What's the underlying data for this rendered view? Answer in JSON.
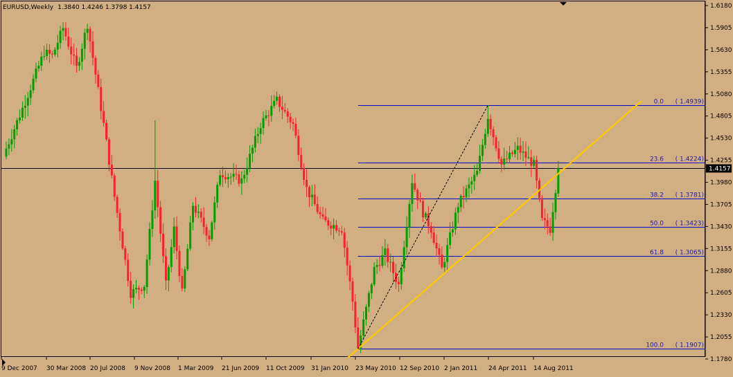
{
  "header": {
    "symbol": "EURUSD,Weekly",
    "ohlc": "1.3840 1.4246 1.3798 1.4157"
  },
  "colors": {
    "background": "#D2AF83",
    "bull": "#00A000",
    "bear": "#FF1E2D",
    "fib_line": "#0000CC",
    "fib_label": "#2020AA",
    "trend_dotted": "#FFC800",
    "trend_dashed": "#000000",
    "price_line": "#000000",
    "current_price_bg": "#000000",
    "current_price_text": "#FFFFFF"
  },
  "chart_data": {
    "type": "candlestick",
    "symbol": "EURUSD",
    "timeframe": "Weekly",
    "current_price": 1.4157,
    "current_price_label": "1.4157",
    "ylim": [
      1.178,
      1.618
    ],
    "y_ticks": [
      "1.6180",
      "1.5905",
      "1.5630",
      "1.5355",
      "1.5080",
      "1.4805",
      "1.4530",
      "1.4255",
      "1.3980",
      "1.3705",
      "1.3430",
      "1.3155",
      "1.2880",
      "1.2605",
      "1.2330",
      "1.2055",
      "1.1780"
    ],
    "x_labels": [
      "9 Dec 2007",
      "30 Mar 2008",
      "20 Jul 2008",
      "9 Nov 2008",
      "1 Mar 2009",
      "21 Jun 2009",
      "11 Oct 2009",
      "31 Jan 2010",
      "23 May 2010",
      "12 Sep 2010",
      "2 Jan 2011",
      "24 Apr 2011",
      "14 Aug 2011"
    ],
    "fibonacci": [
      {
        "level": "0.0",
        "price_label": "( 1.4939)",
        "price": 1.4939
      },
      {
        "level": "23.6",
        "price_label": "( 1.4224)",
        "price": 1.4224
      },
      {
        "level": "38.2",
        "price_label": "( 1.3781)",
        "price": 1.3781
      },
      {
        "level": "50.0",
        "price_label": "( 1.3423)",
        "price": 1.3423
      },
      {
        "level": "61.8",
        "price_label": "( 1.3065)",
        "price": 1.3065
      },
      {
        "level": "100.0",
        "price_label": "( 1.1907)",
        "price": 1.1907
      }
    ],
    "fib_anchor_week": 130,
    "fib_end_week": 208,
    "trendlines": [
      {
        "style": "dotted",
        "from": {
          "week": 130,
          "price": 1.1907
        },
        "to": {
          "week": 235,
          "price": 1.5
        }
      },
      {
        "style": "dashed",
        "from": {
          "week": 130,
          "price": 1.1907
        },
        "to": {
          "week": 178,
          "price": 1.4939
        }
      }
    ],
    "anchors": [
      [
        0,
        1.44
      ],
      [
        6,
        1.49
      ],
      [
        14,
        1.56
      ],
      [
        17,
        1.555
      ],
      [
        21,
        1.59
      ],
      [
        26,
        1.54
      ],
      [
        30,
        1.595
      ],
      [
        36,
        1.47
      ],
      [
        40,
        1.38
      ],
      [
        46,
        1.26
      ],
      [
        51,
        1.27
      ],
      [
        55,
        1.4
      ],
      [
        59,
        1.27
      ],
      [
        62,
        1.34
      ],
      [
        65,
        1.26
      ],
      [
        69,
        1.37
      ],
      [
        75,
        1.33
      ],
      [
        79,
        1.41
      ],
      [
        87,
        1.4
      ],
      [
        94,
        1.47
      ],
      [
        100,
        1.5
      ],
      [
        106,
        1.47
      ],
      [
        111,
        1.39
      ],
      [
        117,
        1.35
      ],
      [
        124,
        1.34
      ],
      [
        128,
        1.25
      ],
      [
        130,
        1.1907
      ],
      [
        136,
        1.29
      ],
      [
        140,
        1.31
      ],
      [
        145,
        1.27
      ],
      [
        150,
        1.4
      ],
      [
        154,
        1.36
      ],
      [
        157,
        1.34
      ],
      [
        161,
        1.29
      ],
      [
        167,
        1.37
      ],
      [
        174,
        1.41
      ],
      [
        178,
        1.48
      ],
      [
        183,
        1.42
      ],
      [
        189,
        1.44
      ],
      [
        195,
        1.42
      ],
      [
        198,
        1.35
      ],
      [
        201,
        1.34
      ],
      [
        204,
        1.4157
      ]
    ]
  }
}
